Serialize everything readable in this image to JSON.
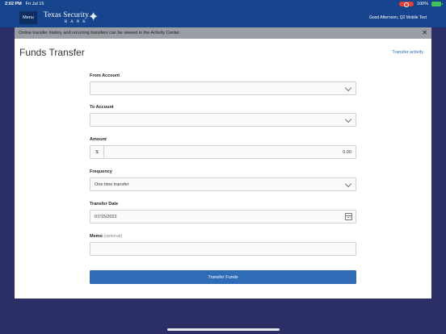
{
  "status_bar": {
    "time": "2:02 PM",
    "date": "Fri Jul 15",
    "battery": "100%"
  },
  "header": {
    "menu_label": "Menu",
    "logo_top": "Texas Security",
    "logo_bottom": "BANK",
    "greeting": "Good Afternoon, Q2 Mobile Test",
    "brand_color": "#16458e"
  },
  "banner": {
    "text": "Online transfer history and recurring transfers can be viewed in the Activity Center.",
    "close": "✕"
  },
  "page": {
    "title": "Funds Transfer",
    "activity_link": "Transfer activity"
  },
  "form": {
    "from_account": {
      "label": "From Account",
      "value": ""
    },
    "to_account": {
      "label": "To Account",
      "value": ""
    },
    "amount": {
      "label": "Amount",
      "prefix": "$",
      "value": "0.00"
    },
    "frequency": {
      "label": "Frequency",
      "value": "One time transfer"
    },
    "transfer_date": {
      "label": "Transfer Date",
      "value": "07/15/2022"
    },
    "memo": {
      "label": "Memo",
      "optional": "(optional)",
      "value": ""
    },
    "submit_label": "Transfer Funds"
  }
}
